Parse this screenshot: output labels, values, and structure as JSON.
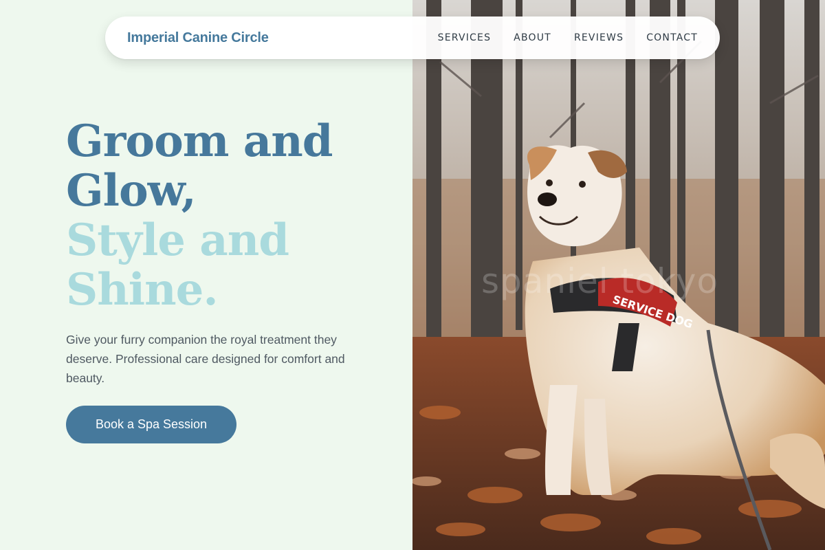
{
  "brand": {
    "name": "Imperial Canine Circle"
  },
  "nav": {
    "items": [
      {
        "label": "SERVICES"
      },
      {
        "label": "ABOUT"
      },
      {
        "label": "REVIEWS"
      },
      {
        "label": "CONTACT"
      }
    ]
  },
  "hero": {
    "headline_line1": "Groom and",
    "headline_line2": "Glow,",
    "headline_line3": "Style and",
    "headline_line4": "Shine.",
    "description": "Give your furry companion the royal treatment they deserve. Professional care designed for comfort and beauty.",
    "cta_label": "Book a Spa Session",
    "image": {
      "harness_text": "SERVICE DOG",
      "watermark": "spaniel tokyo"
    }
  },
  "colors": {
    "brand": "#45799c",
    "headline_dark": "#46789b",
    "headline_light": "#a9dadd",
    "background": "#eef8ee",
    "button": "#46799c"
  }
}
